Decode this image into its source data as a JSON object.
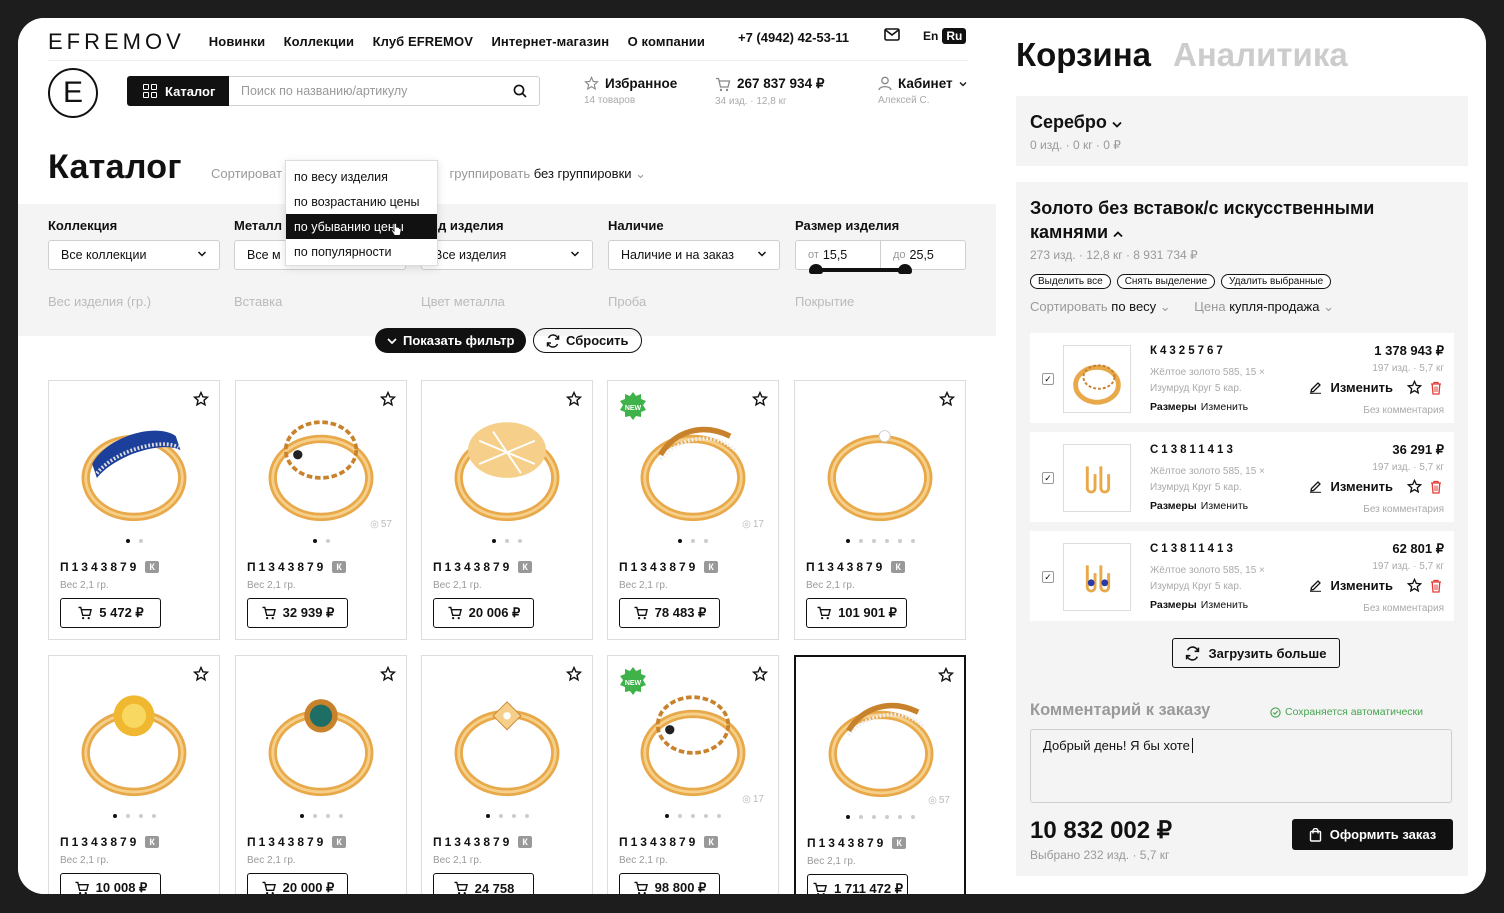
{
  "header": {
    "logo": "EFREMOV",
    "nav": [
      "Новинки",
      "Коллекции",
      "Клуб EFREMOV",
      "Интернет-магазин",
      "О компании"
    ],
    "phone": "+7 (4942) 42-53-11",
    "lang_en": "En",
    "lang_ru": "Ru",
    "logo_letter": "E"
  },
  "toolbar": {
    "catalog_label": "Каталог",
    "search_placeholder": "Поиск по названию/артикулу"
  },
  "favorites": {
    "label": "Избранное",
    "sub": "14 товаров"
  },
  "cart": {
    "label": "267 837 934 ₽",
    "sub": "34 изд. · 12,8 кг"
  },
  "account": {
    "label": "Кабинет",
    "sub": "Алексей С."
  },
  "page": {
    "title": "Каталог",
    "sort_label": "Сортироват",
    "group_label": "группировать",
    "group_value": "без группировки"
  },
  "sort_dropdown": {
    "options": [
      "по весу изделия",
      "по возрастанию цены",
      "по убыванию цены",
      "по популярности"
    ],
    "active": 2
  },
  "filters": {
    "labels": [
      "Коллекция",
      "Металл",
      "д изделия",
      "Наличие",
      "Размер изделия"
    ],
    "values": [
      "Все коллекции",
      "Все м",
      "Все изделия",
      "Наличие и на заказ"
    ],
    "range_from_label": "от",
    "range_from": "15,5",
    "range_to_label": "до",
    "range_to": "25,5",
    "ghost": [
      "Вес изделия (гр.)",
      "Вставка",
      "Цвет металла",
      "Проба",
      "Покрытие"
    ],
    "show_filter": "Показать фильтр",
    "reset": "Сбросить"
  },
  "products": [
    {
      "art": "П1343879",
      "k": "К",
      "weight": "Вес 2,1 гр.",
      "price": "5 472 ₽",
      "count": "",
      "new": false
    },
    {
      "art": "П1343879",
      "k": "К",
      "weight": "Вес 2,1 гр.",
      "price": "32 939 ₽",
      "count": "57",
      "new": false
    },
    {
      "art": "П1343879",
      "k": "К",
      "weight": "Вес 2,1 гр.",
      "price": "20 006 ₽",
      "count": "",
      "new": false
    },
    {
      "art": "П1343879",
      "k": "К",
      "weight": "Вес 2,1 гр.",
      "price": "78 483 ₽",
      "count": "17",
      "new": true
    },
    {
      "art": "П1343879",
      "k": "К",
      "weight": "Вес 2,1 гр.",
      "price": "101 901 ₽",
      "count": "",
      "new": false
    },
    {
      "art": "П1343879",
      "k": "К",
      "weight": "Вес 2,1 гр.",
      "price": "10 008 ₽",
      "count": "",
      "new": false
    },
    {
      "art": "П1343879",
      "k": "К",
      "weight": "Вес 2,1 гр.",
      "price": "20 000 ₽",
      "count": "",
      "new": false
    },
    {
      "art": "П1343879",
      "k": "К",
      "weight": "Вес 2,1 гр.",
      "price": "24 758",
      "count": "",
      "new": false
    },
    {
      "art": "П1343879",
      "k": "К",
      "weight": "Вес 2,1 гр.",
      "price": "98 800 ₽",
      "count": "17",
      "new": true
    },
    {
      "art": "П1343879",
      "k": "К",
      "weight": "Вес 2,1 гр.",
      "price": "1 711 472 ₽",
      "count": "57",
      "new": false
    }
  ],
  "new_badge": "NEW",
  "right": {
    "tab_cart": "Корзина",
    "tab_analytics": "Аналитика",
    "silver": {
      "title": "Серебро",
      "sub": "0 изд. · 0 кг · 0 ₽"
    },
    "gold": {
      "title": "Золото без вставок/с искусственными камнями",
      "sub": "273 изд. · 12,8 кг · 8 931 734 ₽",
      "chips": [
        "Выделить все",
        "Снять выделение",
        "Удалить выбранные"
      ],
      "sort_label": "Сортировать",
      "sort_value": "по весу",
      "price_label": "Цена",
      "price_value": "купля-продажа"
    },
    "items": [
      {
        "art": "К4325767",
        "price": "1 378 943 ₽",
        "qty": "197 изд. · 5,7 кг",
        "desc1": "Жёлтое золото 585, 15 ×",
        "desc2": "Изумруд Круг 5 кар.",
        "sizes": "Размеры",
        "sizes_link": "Изменить",
        "edit": "Изменить",
        "comment": "Без комментария"
      },
      {
        "art": "С13811413",
        "price": "36 291 ₽",
        "qty": "197 изд. · 5,7 кг",
        "desc1": "Жёлтое золото 585, 15 ×",
        "desc2": "Изумруд Круг 5 кар.",
        "sizes": "Размеры",
        "sizes_link": "Изменить",
        "edit": "Изменить",
        "comment": "Без комментария"
      },
      {
        "art": "С13811413",
        "price": "62 801 ₽",
        "qty": "197 изд. · 5,7 кг",
        "desc1": "Жёлтое золото 585, 15 ×",
        "desc2": "Изумруд Круг 5 кар.",
        "sizes": "Размеры",
        "sizes_link": "Изменить",
        "edit": "Изменить",
        "comment": "Без комментария"
      }
    ],
    "load_more": "Загрузить больше",
    "comment_label": "Комментарий к заказу",
    "autosave": "Сохраняется автоматически",
    "comment_text": "Добрый день! Я бы хоте",
    "total": "10 832 002 ₽",
    "total_sub": "Выбрано 232 изд. · 5,7 кг",
    "order_btn": "Оформить заказ"
  },
  "colors": {
    "accent": "#111111",
    "gold": "#e8a94a",
    "new_badge": "#3fb24a",
    "autosave": "#46a54f",
    "delete": "#e53935"
  }
}
